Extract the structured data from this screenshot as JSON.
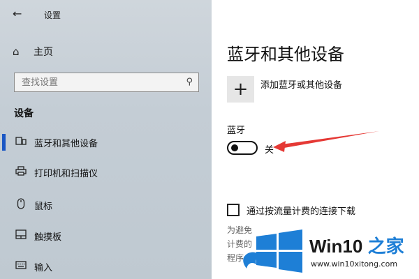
{
  "window": {
    "title": "设置"
  },
  "sidebar": {
    "back_icon": "arrow-left-icon",
    "home_label": "主页",
    "search_placeholder": "查找设置",
    "section_title": "设备",
    "items": [
      {
        "label": "蓝牙和其他设备",
        "icon": "bluetooth-device-icon",
        "selected": true
      },
      {
        "label": "打印机和扫描仪",
        "icon": "printer-icon",
        "selected": false
      },
      {
        "label": "鼠标",
        "icon": "mouse-icon",
        "selected": false
      },
      {
        "label": "触摸板",
        "icon": "touchpad-icon",
        "selected": false
      },
      {
        "label": "输入",
        "icon": "keyboard-icon",
        "selected": false
      }
    ]
  },
  "main": {
    "page_title": "蓝牙和其他设备",
    "add_device_label": "添加蓝牙或其他设备",
    "bluetooth_label": "蓝牙",
    "bluetooth_state": "关",
    "bluetooth_on": false,
    "metered_download_label": "通过按流量计费的连接下载",
    "metered_download_checked": false,
    "metered_desc_lines": [
      "为避免",
      "计费的",
      "程序"
    ]
  },
  "watermark": {
    "brand_prefix": "Win10",
    "brand_suffix": "之家",
    "url": "www.win10xitong.com"
  },
  "colors": {
    "accent": "#1a56c4",
    "annotation_arrow": "#e53935",
    "watermark_blue": "#1e7fd6"
  }
}
